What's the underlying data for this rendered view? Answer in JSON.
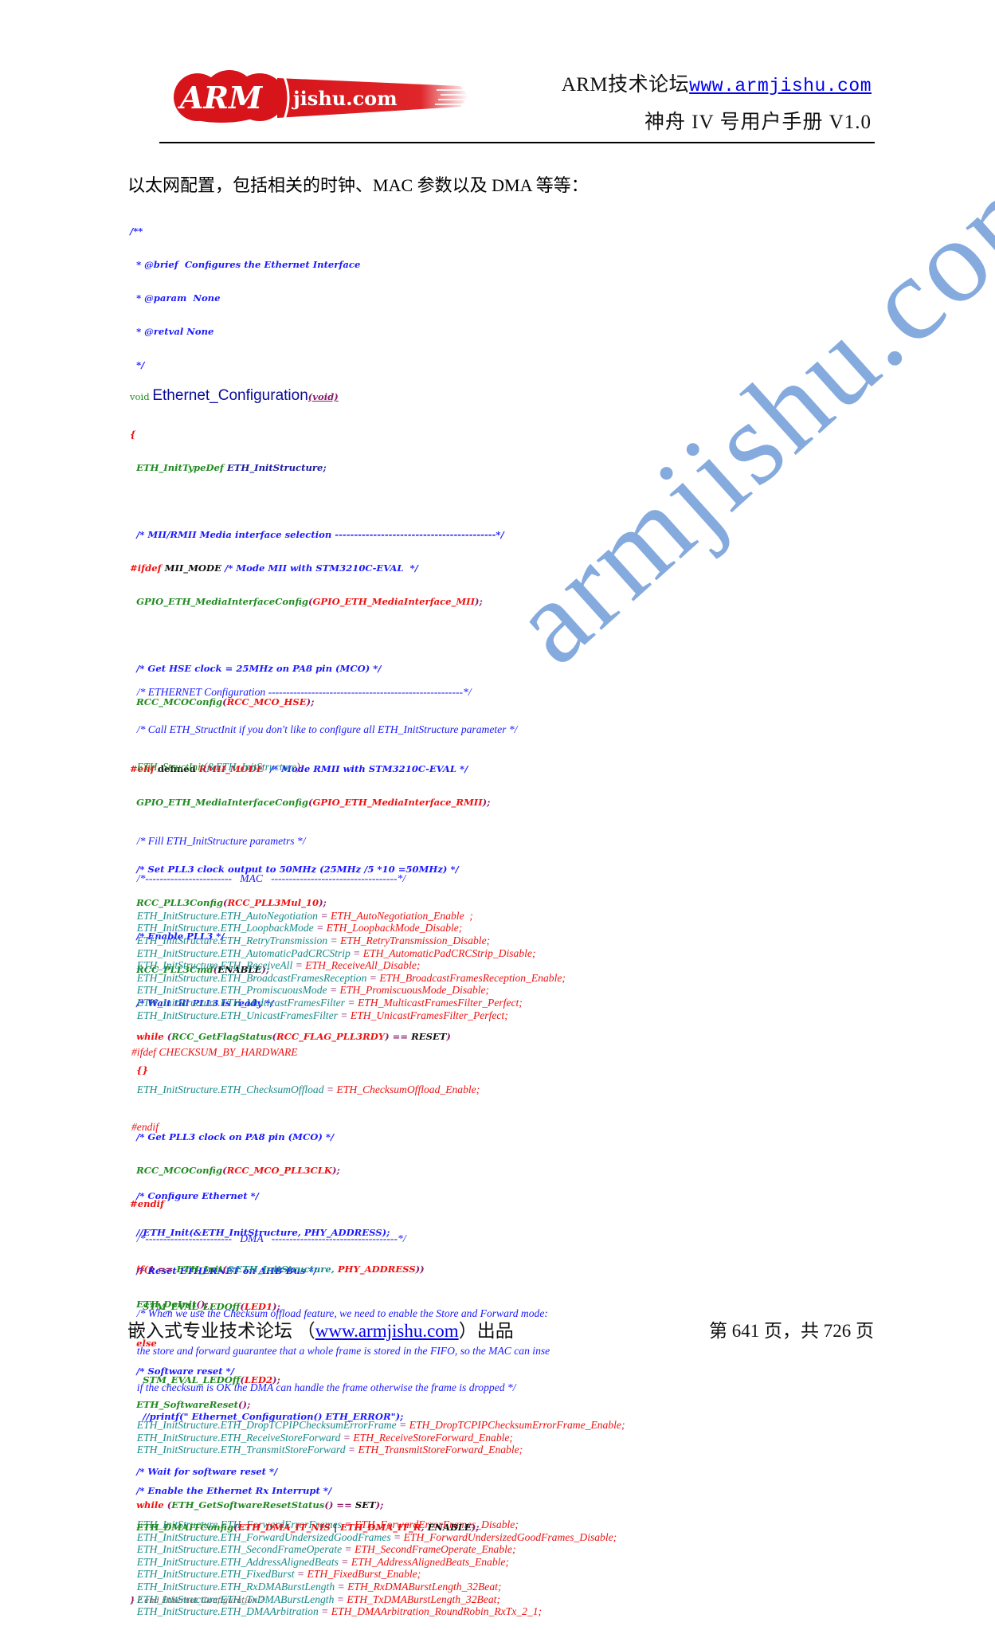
{
  "header": {
    "logo_text_left": "ARM",
    "logo_text_right": "jishu.com",
    "forum_label": "ARM技术论坛",
    "forum_url": "www.armjishu.com",
    "manual_title": "神舟 IV 号用户手册 V1.0",
    "brand_color": "#d7141a"
  },
  "intro": "以太网配置，包括相关的时钟、MAC 参数以及 DMA 等等：",
  "code": {
    "doc": [
      "/**",
      "  * @brief  Configures the Ethernet Interface",
      "  * @param  None",
      "  * @retval None",
      "  */"
    ],
    "sig_void": "void ",
    "sig_name": "Ethernet_Configuration",
    "sig_args": "(void)",
    "open_brace": "{",
    "decl_type": "ETH_InitTypeDef ",
    "decl_var": "ETH_InitStructure;",
    "c_media": "/* MII/RMII Media interface selection ------------------------------------------*/",
    "ifdef_kw": "#ifdef",
    "mii_mode": " MII_MODE ",
    "c_mii": "/* Mode MII with STM3210C-EVAL  */",
    "gpio_fn": "GPIO_ETH_MediaInterfaceConfig",
    "gpio_mii": "GPIO_ETH_MediaInterface_MII",
    "c_hse": "/* Get HSE clock = 25MHz on PA8 pin (MCO) */",
    "mco_fn": "RCC_MCOConfig",
    "mco_hse": "RCC_MCO_HSE",
    "elif_kw": "#elif",
    "defined_kw": " defined ",
    "rmii_mode": "RMII_MODE",
    "c_rmii": "  /* Mode RMII with STM3210C-EVAL */",
    "gpio_rmii": "GPIO_ETH_MediaInterface_RMII",
    "c_pll3": "/* Set PLL3 clock output to 50MHz (25MHz /5 *10 =50MHz) */",
    "pll3cfg_fn": "RCC_PLL3Config",
    "pll3mul": "RCC_PLL3Mul_10",
    "c_en_pll3": "/* Enable PLL3 */",
    "pll3cmd_fn": "RCC_PLL3Cmd",
    "enable_kw": "ENABLE",
    "c_wait_pll3": "/* Wait till PLL3 is ready */",
    "while_kw": "while ",
    "getflag_fn": "RCC_GetFlagStatus",
    "flag_pll3": "RCC_FLAG_PLL3RDY",
    "eq_op": " == ",
    "reset_kw": "RESET",
    "empty_block": "{}",
    "c_pll3_mco": "/* Get PLL3 clock on PA8 pin (MCO) */",
    "mco_pll3": "RCC_MCO_PLL3CLK",
    "endif_kw": "#endif",
    "c_reset_eth": "/* Reset ETHERNET on AHB Bus */",
    "deinit_fn": "ETH_DeInit",
    "c_sw_reset": "/* Software reset */",
    "swreset_fn": "ETH_SoftwareReset",
    "c_wait_sw": "/* Wait for software reset */",
    "getsw_fn": "ETH_GetSoftwareResetStatus",
    "set_kw": "SET",
    "c_eth_cfg": "/* ETHERNET Configuration ------------------------------------------------------*/",
    "c_call_struct": "/* Call ETH_StructInit if you don't like to configure all ETH_InitStructure parameter */",
    "structinit_fn": "ETH_StructInit",
    "structinit_arg": "&ETH_InitStructure",
    "c_fill": "/* Fill ETH_InitStructure parametrs */",
    "c_mac": "/*------------------------   MAC   -----------------------------------*/",
    "mac_assign": [
      {
        "field": "ETH_InitStructure.ETH_AutoNegotiation",
        "value": "ETH_AutoNegotiation_Enable  ;"
      },
      {
        "field": "ETH_InitStructure.ETH_LoopbackMode",
        "value": "ETH_LoopbackMode_Disable;"
      },
      {
        "field": "ETH_InitStructure.ETH_RetryTransmission",
        "value": "ETH_RetryTransmission_Disable;"
      },
      {
        "field": "ETH_InitStructure.ETH_AutomaticPadCRCStrip",
        "value": "ETH_AutomaticPadCRCStrip_Disable;"
      },
      {
        "field": "ETH_InitStructure.ETH_ReceiveAll",
        "value": "ETH_ReceiveAll_Disable;"
      },
      {
        "field": "ETH_InitStructure.ETH_BroadcastFramesReception",
        "value": "ETH_BroadcastFramesReception_Enable;"
      },
      {
        "field": "ETH_InitStructure.ETH_PromiscuousMode",
        "value": "ETH_PromiscuousMode_Disable;"
      },
      {
        "field": "ETH_InitStructure.ETH_MulticastFramesFilter",
        "value": "ETH_MulticastFramesFilter_Perfect;"
      },
      {
        "field": "ETH_InitStructure.ETH_UnicastFramesFilter",
        "value": "ETH_UnicastFramesFilter_Perfect;"
      }
    ],
    "ifdef_checksum": "CHECKSUM_BY_HARDWARE",
    "checksum_assign": {
      "field": "ETH_InitStructure.ETH_ChecksumOffload",
      "value": "ETH_ChecksumOffload_Enable;"
    },
    "c_dma": "/*------------------------   DMA   -----------------------------------*/",
    "c_when": [
      "/* When we use the Checksum offload feature, we need to enable the Store and Forward mode:",
      "the store and forward guarantee that a whole frame is stored in the FIFO, so the MAC can inse",
      "if the checksum is OK the DMA can handle the frame otherwise the frame is dropped */"
    ],
    "dma_assign_a": [
      {
        "field": "ETH_InitStructure.ETH_DropTCPIPChecksumErrorFrame",
        "value": "ETH_DropTCPIPChecksumErrorFrame_Enable;"
      },
      {
        "field": "ETH_InitStructure.ETH_ReceiveStoreForward",
        "value": "ETH_ReceiveStoreForward_Enable;"
      },
      {
        "field": "ETH_InitStructure.ETH_TransmitStoreForward",
        "value": "ETH_TransmitStoreForward_Enable;"
      }
    ],
    "dma_assign_b": [
      {
        "field": "ETH_InitStructure.ETH_ForwardErrorFrames",
        "value": "ETH_ForwardErrorFrames_Disable;"
      },
      {
        "field": "ETH_InitStructure.ETH_ForwardUndersizedGoodFrames",
        "value": "ETH_ForwardUndersizedGoodFrames_Disable;"
      },
      {
        "field": "ETH_InitStructure.ETH_SecondFrameOperate",
        "value": "ETH_SecondFrameOperate_Enable;"
      },
      {
        "field": "ETH_InitStructure.ETH_AddressAlignedBeats",
        "value": "ETH_AddressAlignedBeats_Enable;"
      },
      {
        "field": "ETH_InitStructure.ETH_FixedBurst",
        "value": "ETH_FixedBurst_Enable;"
      },
      {
        "field": "ETH_InitStructure.ETH_RxDMABurstLength",
        "value": "ETH_RxDMABurstLength_32Beat;"
      },
      {
        "field": "ETH_InitStructure.ETH_TxDMABurstLength",
        "value": "ETH_TxDMABurstLength_32Beat;"
      },
      {
        "field": "ETH_InitStructure.ETH_DMAArbitration",
        "value": "ETH_DMAArbitration_RoundRobin_RxTx_2_1;"
      }
    ],
    "c_configure": "/* Configure Ethernet */",
    "c_eth_init": "//ETH_Init(&ETH_InitStructure, PHY_ADDRESS);",
    "if_kw": "if(",
    "one_eq": "1 == ",
    "ethinit_fn": "ETH_Init",
    "ethinit_arg1": "&ETH_InitStructure, ",
    "phy_addr": "PHY_ADDRESS",
    "led_fn": "STM_EVAL_LEDOff",
    "led1": "LED1",
    "else_kw": "else",
    "led2": "LED2",
    "c_printf": "//printf(\" Ethernet_Configuration() ETH_ERROR\");",
    "c_enable_rx": "/* Enable the Ethernet Rx Interrupt */",
    "dmait_fn": "ETH_DMAITConfig",
    "dma_it_nis": "ETH_DMA_IT_NIS",
    "pipe": " | ",
    "dma_it_r": "ETH_DMA_IT_R",
    "close_brace": "}",
    "end_comment": " ? end Ethernet_Configuration ?"
  },
  "watermark": {
    "text": "armjishu.com",
    "color": "#7fa6dc"
  },
  "footer": {
    "left_text": "嵌入式专业技术论坛 （",
    "left_url": "www.armjishu.com",
    "left_suffix": "）出品",
    "page_info": "第 641 页，共 726 页"
  }
}
